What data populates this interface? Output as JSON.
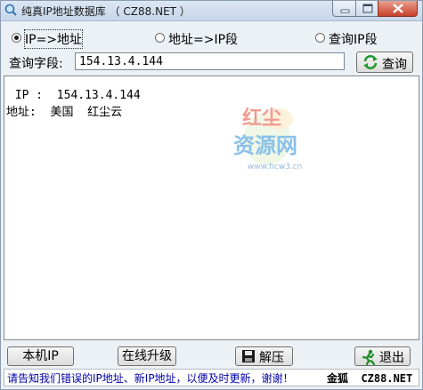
{
  "window": {
    "title": "纯真IP地址数据库 （ CZ88.NET ）"
  },
  "radios": [
    {
      "label": "IP=>地址",
      "checked": true
    },
    {
      "label": "地址=>IP段",
      "checked": false
    },
    {
      "label": "查询IP段",
      "checked": false
    }
  ],
  "query": {
    "label": "查询字段:",
    "value": "154.13.4.144",
    "button_label": "查询"
  },
  "result": {
    "ip_line": " IP :  154.13.4.144",
    "addr_line": "地址:  美国  红尘云"
  },
  "watermark": {
    "line1": "红尘",
    "line2": "资源网",
    "url": "www.hcw3.cn"
  },
  "buttons": {
    "local_ip": "本机IP",
    "online_update": "在线升级",
    "unzip": "解压",
    "exit": "退出"
  },
  "status": {
    "message": "请告知我们错误的IP地址、新IP地址，以便及时更新，谢谢！",
    "brand": "金狐  CZ88.NET"
  },
  "icons": {
    "app": "search-icon",
    "refresh": "refresh-icon",
    "disk": "save-icon",
    "exit": "running-man-icon"
  },
  "colors": {
    "status_text": "#0000aa",
    "close_button": "#c7402a"
  }
}
